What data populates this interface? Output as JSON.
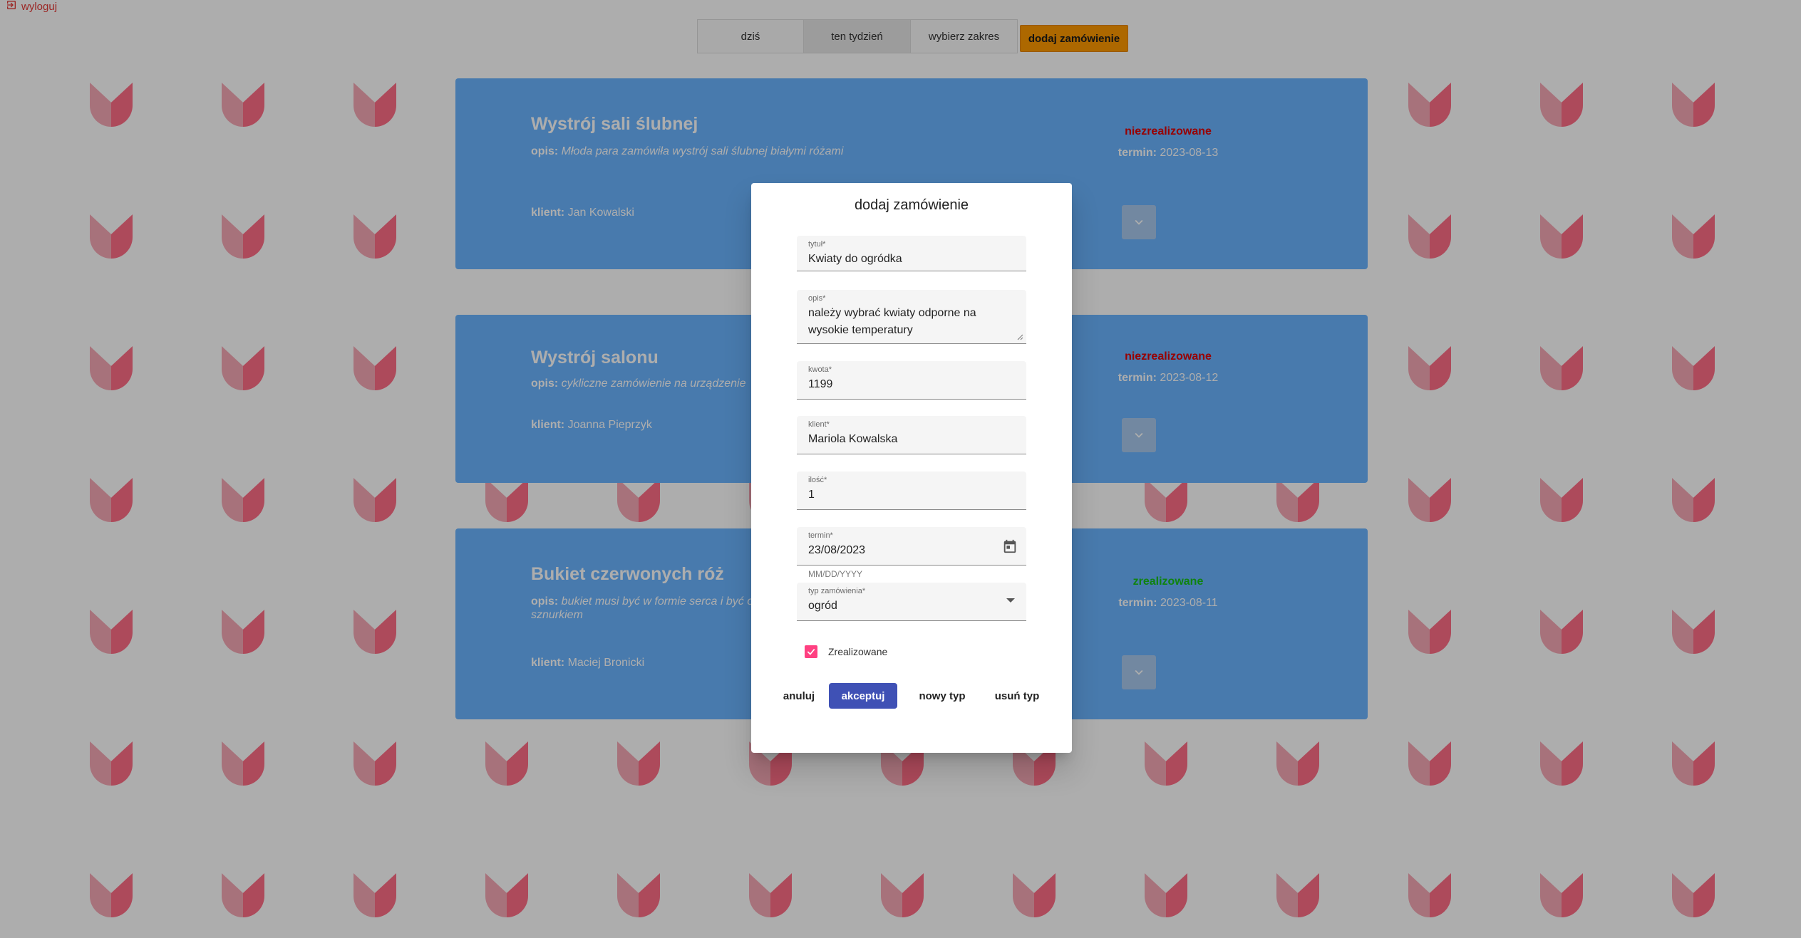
{
  "header": {
    "logout_label": "wyloguj"
  },
  "tabs": [
    {
      "label": "dziś"
    },
    {
      "label": "ten tydzień"
    },
    {
      "label": "wybierz zakres"
    }
  ],
  "add_order_button": "dodaj zamówienie",
  "orders": [
    {
      "title": "Wystrój sali ślubnej",
      "desc_label": "opis:",
      "desc": "Młoda para zamówiła wystrój sali ślubnej białymi różami",
      "client_label": "klient:",
      "client": "Jan Kowalski",
      "status": "niezrealizowane",
      "status_color": "#e00000",
      "term_label": "termin:",
      "term": "2023-08-13"
    },
    {
      "title": "Wystrój salonu",
      "desc_label": "opis:",
      "desc": "cykliczne zamówienie na urządzenie",
      "client_label": "klient:",
      "client": "Joanna Pieprzyk",
      "status": "niezrealizowane",
      "status_color": "#e00000",
      "term_label": "termin:",
      "term": "2023-08-12"
    },
    {
      "title": "Bukiet czerwonych róż",
      "desc_label": "opis:",
      "desc": "bukiet musi być w formie serca i być ozdobnym sznurkiem",
      "client_label": "klient:",
      "client": "Maciej Bronicki",
      "status": "zrealizowane",
      "status_color": "#17c217",
      "term_label": "termin:",
      "term": "2023-08-11"
    }
  ],
  "dialog": {
    "title": "dodaj zamówienie",
    "fields": {
      "title": {
        "label": "tytuł*",
        "value": "Kwiaty do ogródka"
      },
      "description": {
        "label": "opis*",
        "value": "należy wybrać kwiaty odporne na wysokie temperatury"
      },
      "amount": {
        "label": "kwota*",
        "value": "1199"
      },
      "client": {
        "label": "klient*",
        "value": "Mariola Kowalska"
      },
      "quantity": {
        "label": "ilość*",
        "value": "1"
      },
      "date": {
        "label": "termin*",
        "value": "23/08/2023",
        "hint": "MM/DD/YYYY"
      },
      "type": {
        "label": "typ zamówienia*",
        "value": "ogród"
      }
    },
    "checkbox": {
      "label": "Zrealizowane",
      "checked": true
    },
    "buttons": {
      "cancel": "anuluj",
      "accept": "akceptuj",
      "new_type": "nowy typ",
      "delete_type": "usuń typ"
    }
  },
  "colors": {
    "card_bg": "#6ab4ff",
    "accent_orange": "#ff9a00",
    "primary_button": "#3f51b5",
    "checkbox": "#ff4081",
    "logout": "#e53935"
  },
  "icons": {
    "logout": "logout-icon",
    "calendar": "calendar-icon",
    "select": "dropdown-arrow-icon",
    "checkbox": "check-icon",
    "expand": "chevron-down-icon"
  }
}
